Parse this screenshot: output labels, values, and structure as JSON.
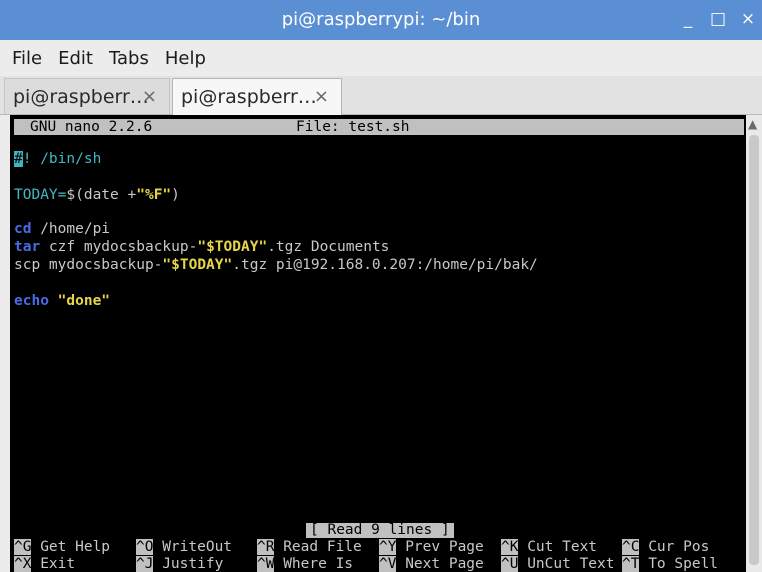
{
  "window": {
    "title": "pi@raspberrypi: ~/bin",
    "minimize": "_",
    "maximize": "□",
    "close": "×"
  },
  "menu": [
    "File",
    "Edit",
    "Tabs",
    "Help"
  ],
  "tabs": [
    {
      "label": "pi@raspberr…",
      "close": "×",
      "active": false
    },
    {
      "label": "pi@raspberr…",
      "close": "×",
      "active": true
    }
  ],
  "nano": {
    "version": "GNU nano 2.2.6",
    "file": "File: test.sh",
    "lines": [
      {
        "a": "#",
        "b": "! /bin/sh"
      },
      {
        "a": "TODAY=",
        "b": "$(date +",
        "c": "\"%F\"",
        "d": ")"
      },
      {
        "a": "cd",
        "b": " /home/pi"
      },
      {
        "a": "tar",
        "b": " czf mydocsbackup-",
        "c": "\"$TODAY\"",
        "d": ".tgz Documents"
      },
      {
        "a": "scp mydocsbackup-",
        "c": "\"$TODAY\"",
        "d": ".tgz pi@192.168.0.207:/home/pi/bak/"
      },
      {
        "a": "echo",
        "c": "\"done\""
      }
    ],
    "status": "[ Read 9 lines ]",
    "shortcuts": [
      {
        "key": "^G",
        "label": "Get Help"
      },
      {
        "key": "^O",
        "label": "WriteOut"
      },
      {
        "key": "^R",
        "label": "Read File"
      },
      {
        "key": "^Y",
        "label": "Prev Page"
      },
      {
        "key": "^K",
        "label": "Cut Text"
      },
      {
        "key": "^C",
        "label": "Cur Pos"
      },
      {
        "key": "^X",
        "label": "Exit"
      },
      {
        "key": "^J",
        "label": "Justify"
      },
      {
        "key": "^W",
        "label": "Where Is"
      },
      {
        "key": "^V",
        "label": "Next Page"
      },
      {
        "key": "^U",
        "label": "UnCut Text"
      },
      {
        "key": "^T",
        "label": "To Spell"
      }
    ]
  },
  "colors": {
    "titlebar": "#5b8fd3",
    "terminal_bg": "#000000",
    "keyword": "#4a6be8",
    "string": "#e6d64a",
    "comment": "#44b6c4"
  }
}
